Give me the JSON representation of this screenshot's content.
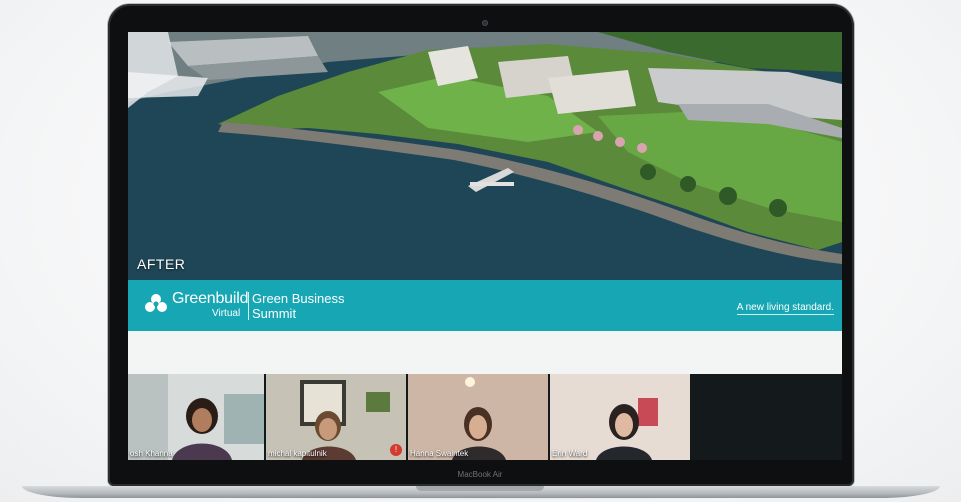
{
  "slide": {
    "label": "AFTER"
  },
  "banner": {
    "brand_name": "Greenbuild",
    "brand_sub": "Virtual",
    "event_line1": "Green Business",
    "event_line2": "Summit",
    "tagline": "A new living standard."
  },
  "participants": [
    {
      "name": "osh Khanna",
      "active": true,
      "muted": false
    },
    {
      "name": "michal kapitulnik",
      "active": false,
      "muted": true
    },
    {
      "name": "Hanna Swaintek",
      "active": false,
      "muted": false
    },
    {
      "name": "Erin Ward",
      "active": false,
      "muted": false
    }
  ],
  "mute_badge_glyph": "!",
  "device": {
    "model_label": "MacBook Air"
  },
  "colors": {
    "banner_teal": "#17a7b4",
    "active_speaker": "#4dc65a",
    "mute_red": "#d23b2e"
  }
}
